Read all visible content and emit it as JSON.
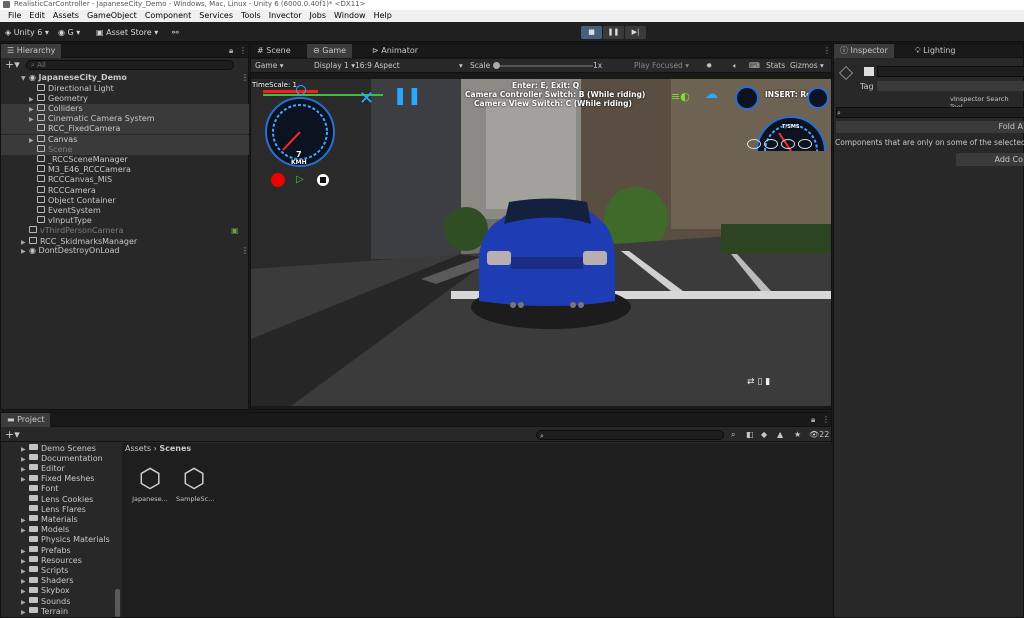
{
  "window": {
    "title": "RealisticCarController - JapaneseCity_Demo - Windows, Mac, Linux - Unity 6 (6000.0.40f1)* <DX11>"
  },
  "menu": [
    "File",
    "Edit",
    "Assets",
    "GameObject",
    "Component",
    "Services",
    "Tools",
    "Invector",
    "Jobs",
    "Window",
    "Help"
  ],
  "toolbar": {
    "unity_label": "Unity 6",
    "account_label": "G",
    "asset_store_label": "Asset Store"
  },
  "hierarchy": {
    "tab": "Hierarchy",
    "search_placeholder": "All",
    "scene_name": "JapaneseCity_Demo",
    "items": [
      {
        "label": "Directional Light"
      },
      {
        "label": "Geometry"
      },
      {
        "label": "Colliders"
      },
      {
        "label": "Cinematic Camera System"
      },
      {
        "label": "RCC_FixedCamera"
      },
      {
        "label": "Canvas"
      },
      {
        "label": "Scene"
      },
      {
        "label": "_RCCSceneManager"
      },
      {
        "label": "M3_E46_RCCCamera"
      },
      {
        "label": "RCCCanvas_MIS"
      },
      {
        "label": "RCCCamera"
      },
      {
        "label": "Object Container"
      },
      {
        "label": "EventSystem"
      },
      {
        "label": "vInputType"
      },
      {
        "label": "vThirdPersonCamera"
      },
      {
        "label": "RCC_SkidmarksManager"
      }
    ],
    "dont_destroy": "DontDestroyOnLoad"
  },
  "view_tabs": {
    "scene": "Scene",
    "game": "Game",
    "animator": "Animator"
  },
  "game_toolbar": {
    "display_mode": "Game",
    "display": "Display 1",
    "aspect": "16:9 Aspect",
    "scale_label": "Scale",
    "scale_value": "1x",
    "play_focused": "Play Focused",
    "stats": "Stats",
    "gizmos": "Gizmos"
  },
  "hud": {
    "timescale": "TimeScale: 1",
    "controls_line1": "Enter: E, Exit: Q",
    "controls_line2": "Camera Controller Switch: B (While riding)",
    "controls_line3": "Camera View Switch: C (While riding)",
    "insert_text": "INSERT: Reset",
    "speed": "7",
    "speed_unit": "KMH",
    "gauge_label": "T/SMS"
  },
  "inspector": {
    "tab": "Inspector",
    "tab2": "Lighting",
    "tag_label": "Tag",
    "tool_label": "vInspector Search Tool",
    "fold_button": "Fold A",
    "message": "Components that are only on some of the selected o",
    "add_button": "Add Co"
  },
  "project": {
    "tab": "Project",
    "breadcrumb_root": "Assets",
    "breadcrumb_current": "Scenes",
    "hidden_count": "22",
    "folders": [
      {
        "label": "Demo Scenes",
        "exp": true
      },
      {
        "label": "Documentation",
        "exp": true
      },
      {
        "label": "Editor",
        "exp": true
      },
      {
        "label": "Fixed Meshes",
        "exp": true
      },
      {
        "label": "Font",
        "exp": false
      },
      {
        "label": "Lens Cookies",
        "exp": false
      },
      {
        "label": "Lens Flares",
        "exp": false
      },
      {
        "label": "Materials",
        "exp": true
      },
      {
        "label": "Models",
        "exp": true
      },
      {
        "label": "Physics Materials",
        "exp": false
      },
      {
        "label": "Prefabs",
        "exp": true
      },
      {
        "label": "Resources",
        "exp": true
      },
      {
        "label": "Scripts",
        "exp": true
      },
      {
        "label": "Shaders",
        "exp": true
      },
      {
        "label": "Skybox",
        "exp": true
      },
      {
        "label": "Sounds",
        "exp": true
      },
      {
        "label": "Terrain",
        "exp": true
      }
    ],
    "assets": [
      {
        "label": "Japanese..."
      },
      {
        "label": "SampleSc..."
      }
    ]
  },
  "colors": {
    "accent": "#46607c",
    "panel": "#282828",
    "background": "#191919",
    "car": "#1e3db5",
    "hud_red": "#ff1a1a",
    "hud_blue": "#2aa8ff"
  }
}
